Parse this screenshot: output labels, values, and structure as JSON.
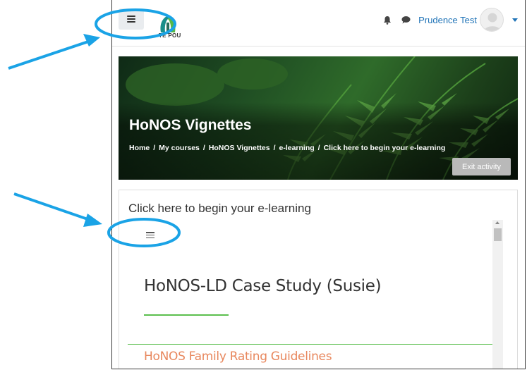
{
  "navbar": {
    "logo_text": "TE POU",
    "user_name": "Prudence Test"
  },
  "hero": {
    "title": "HoNOS Vignettes",
    "breadcrumb": [
      "Home",
      "My courses",
      "HoNOS Vignettes",
      "e-learning",
      "Click here to begin your e-learning"
    ],
    "breadcrumb_separator": "/",
    "exit_label": "Exit activity"
  },
  "activity": {
    "title": "Click here to begin your e-learning",
    "case_title": "HoNOS-LD Case Study (Susie)",
    "section_heading": "HoNOS Family Rating Guidelines"
  },
  "colors": {
    "accent_blue": "#1f73b7",
    "annotation_blue": "#1aa3e6",
    "green_rule": "#5bbf4e",
    "orange_heading": "#e8875d"
  }
}
